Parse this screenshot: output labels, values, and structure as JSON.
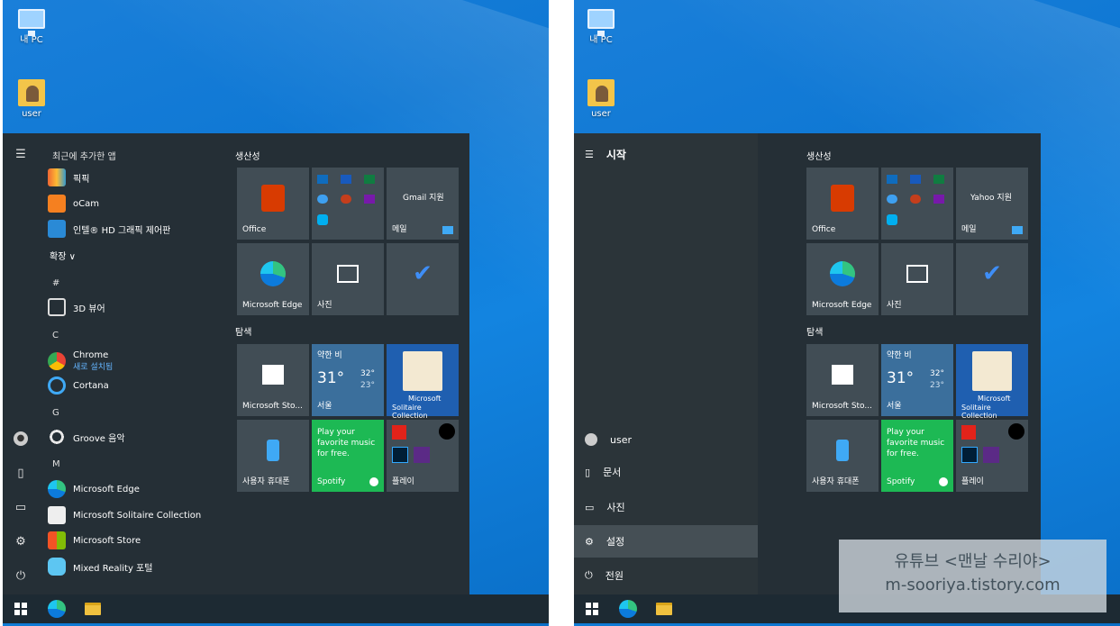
{
  "desktop": {
    "icons": [
      {
        "label": "내 PC"
      },
      {
        "label": "user"
      }
    ]
  },
  "left": {
    "list_header": "최근에 추가한 앱",
    "apps": [
      {
        "name": "픽픽"
      },
      {
        "name": "oCam"
      },
      {
        "name": "인텔® HD 그래픽 제어판"
      },
      {
        "name": "확장 ∨"
      },
      {
        "name": "#"
      },
      {
        "name": "3D 뷰어"
      },
      {
        "name": "C"
      },
      {
        "name": "Chrome",
        "sub": "새로 설치됨"
      },
      {
        "name": "Cortana"
      },
      {
        "name": "G"
      },
      {
        "name": "Groove 음악"
      },
      {
        "name": "M"
      },
      {
        "name": "Microsoft Edge"
      },
      {
        "name": "Microsoft Solitaire Collection"
      },
      {
        "name": "Microsoft Store"
      },
      {
        "name": "Mixed Reality 포털"
      }
    ],
    "tiles": {
      "section_productivity": "생산성",
      "section_explore": "탐색",
      "office": "Office",
      "mail_top": "Gmail 지원",
      "mail": "메일",
      "edge": "Microsoft Edge",
      "photos": "사진",
      "store": "Microsoft Sto...",
      "weather_top": "약한 비",
      "weather_temp": "31°",
      "weather_hi": "32°",
      "weather_lo": "23°",
      "weather_city": "서울",
      "solitaire1": "Microsoft",
      "solitaire2": "Solitaire Collection",
      "phone": "사용자 휴대폰",
      "spotify_text": "Play your favorite music for free.",
      "spotify": "Spotify",
      "play": "플레이"
    }
  },
  "right": {
    "title": "시작",
    "nav": [
      {
        "label": "user"
      },
      {
        "label": "문서"
      },
      {
        "label": "사진"
      },
      {
        "label": "설정"
      },
      {
        "label": "전원"
      }
    ],
    "tiles": {
      "section_productivity": "생산성",
      "section_explore": "탐색",
      "office": "Office",
      "mail_top": "Yahoo 지원",
      "mail": "메일",
      "edge": "Microsoft Edge",
      "photos": "사진",
      "store": "Microsoft Sto...",
      "weather_top": "약한 비",
      "weather_temp": "31°",
      "weather_hi": "32°",
      "weather_lo": "23°",
      "weather_city": "서울",
      "solitaire1": "Microsoft",
      "solitaire2": "Solitaire Collection",
      "phone": "사용자 휴대폰",
      "spotify_text": "Play your favorite music for free.",
      "spotify": "Spotify",
      "play": "플레이"
    }
  },
  "watermark": {
    "line1": "유튜브 <맨날 수리야>",
    "line2": "m-sooriya.tistory.com"
  }
}
